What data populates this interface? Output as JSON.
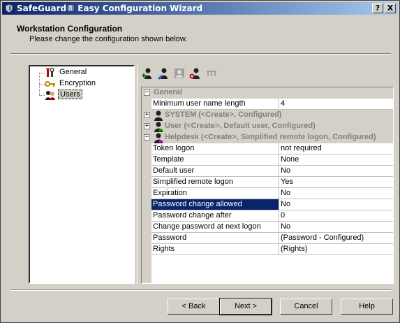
{
  "window": {
    "title": "SafeGuard® Easy Configuration Wizard",
    "help_button": "?",
    "close_button": "X"
  },
  "header": {
    "title": "Workstation Configuration",
    "subtitle": "Please change the configuration shown below."
  },
  "tree": {
    "items": [
      {
        "label": "General",
        "icon": "tools-icon"
      },
      {
        "label": "Encryption",
        "icon": "key-icon"
      },
      {
        "label": "Users",
        "icon": "users-icon",
        "selected": true
      }
    ]
  },
  "toolbar": {
    "tools": [
      "add-user-icon",
      "edit-user-icon",
      "copy-user-icon",
      "delete-user-icon",
      "properties-icon"
    ]
  },
  "grid": {
    "general": {
      "label": "General",
      "rows": [
        {
          "name": "Minimum user name length",
          "value": "4"
        }
      ]
    },
    "system": {
      "label": "SYSTEM (<Create>, Configured)"
    },
    "user": {
      "label": "User (<Create>, Default user, Configured)"
    },
    "helpdesk": {
      "label": "Helpdesk (<Create>, Simplified remote logon, Configured)",
      "rows": [
        {
          "name": "Token logon",
          "value": "not required"
        },
        {
          "name": "Template",
          "value": "None"
        },
        {
          "name": "Default user",
          "value": "No"
        },
        {
          "name": "Simplified remote logon",
          "value": "Yes"
        },
        {
          "name": "Expiration",
          "value": "No"
        },
        {
          "name": "Password change allowed",
          "value": "No",
          "selected": true
        },
        {
          "name": "Password change after",
          "value": "0"
        },
        {
          "name": "Change password at next logon",
          "value": "No"
        },
        {
          "name": "Password",
          "value": "(Password - Configured)"
        },
        {
          "name": "Rights",
          "value": "(Rights)"
        }
      ]
    },
    "collapse_symbol": "−",
    "expand_symbol": "+"
  },
  "buttons": {
    "back": "< Back",
    "next": "Next >",
    "cancel": "Cancel",
    "help": "Help"
  },
  "colors": {
    "title_start": "#0a246a",
    "title_end": "#a6caf0",
    "selection": "#0a246a",
    "face": "#d4d0c8"
  }
}
